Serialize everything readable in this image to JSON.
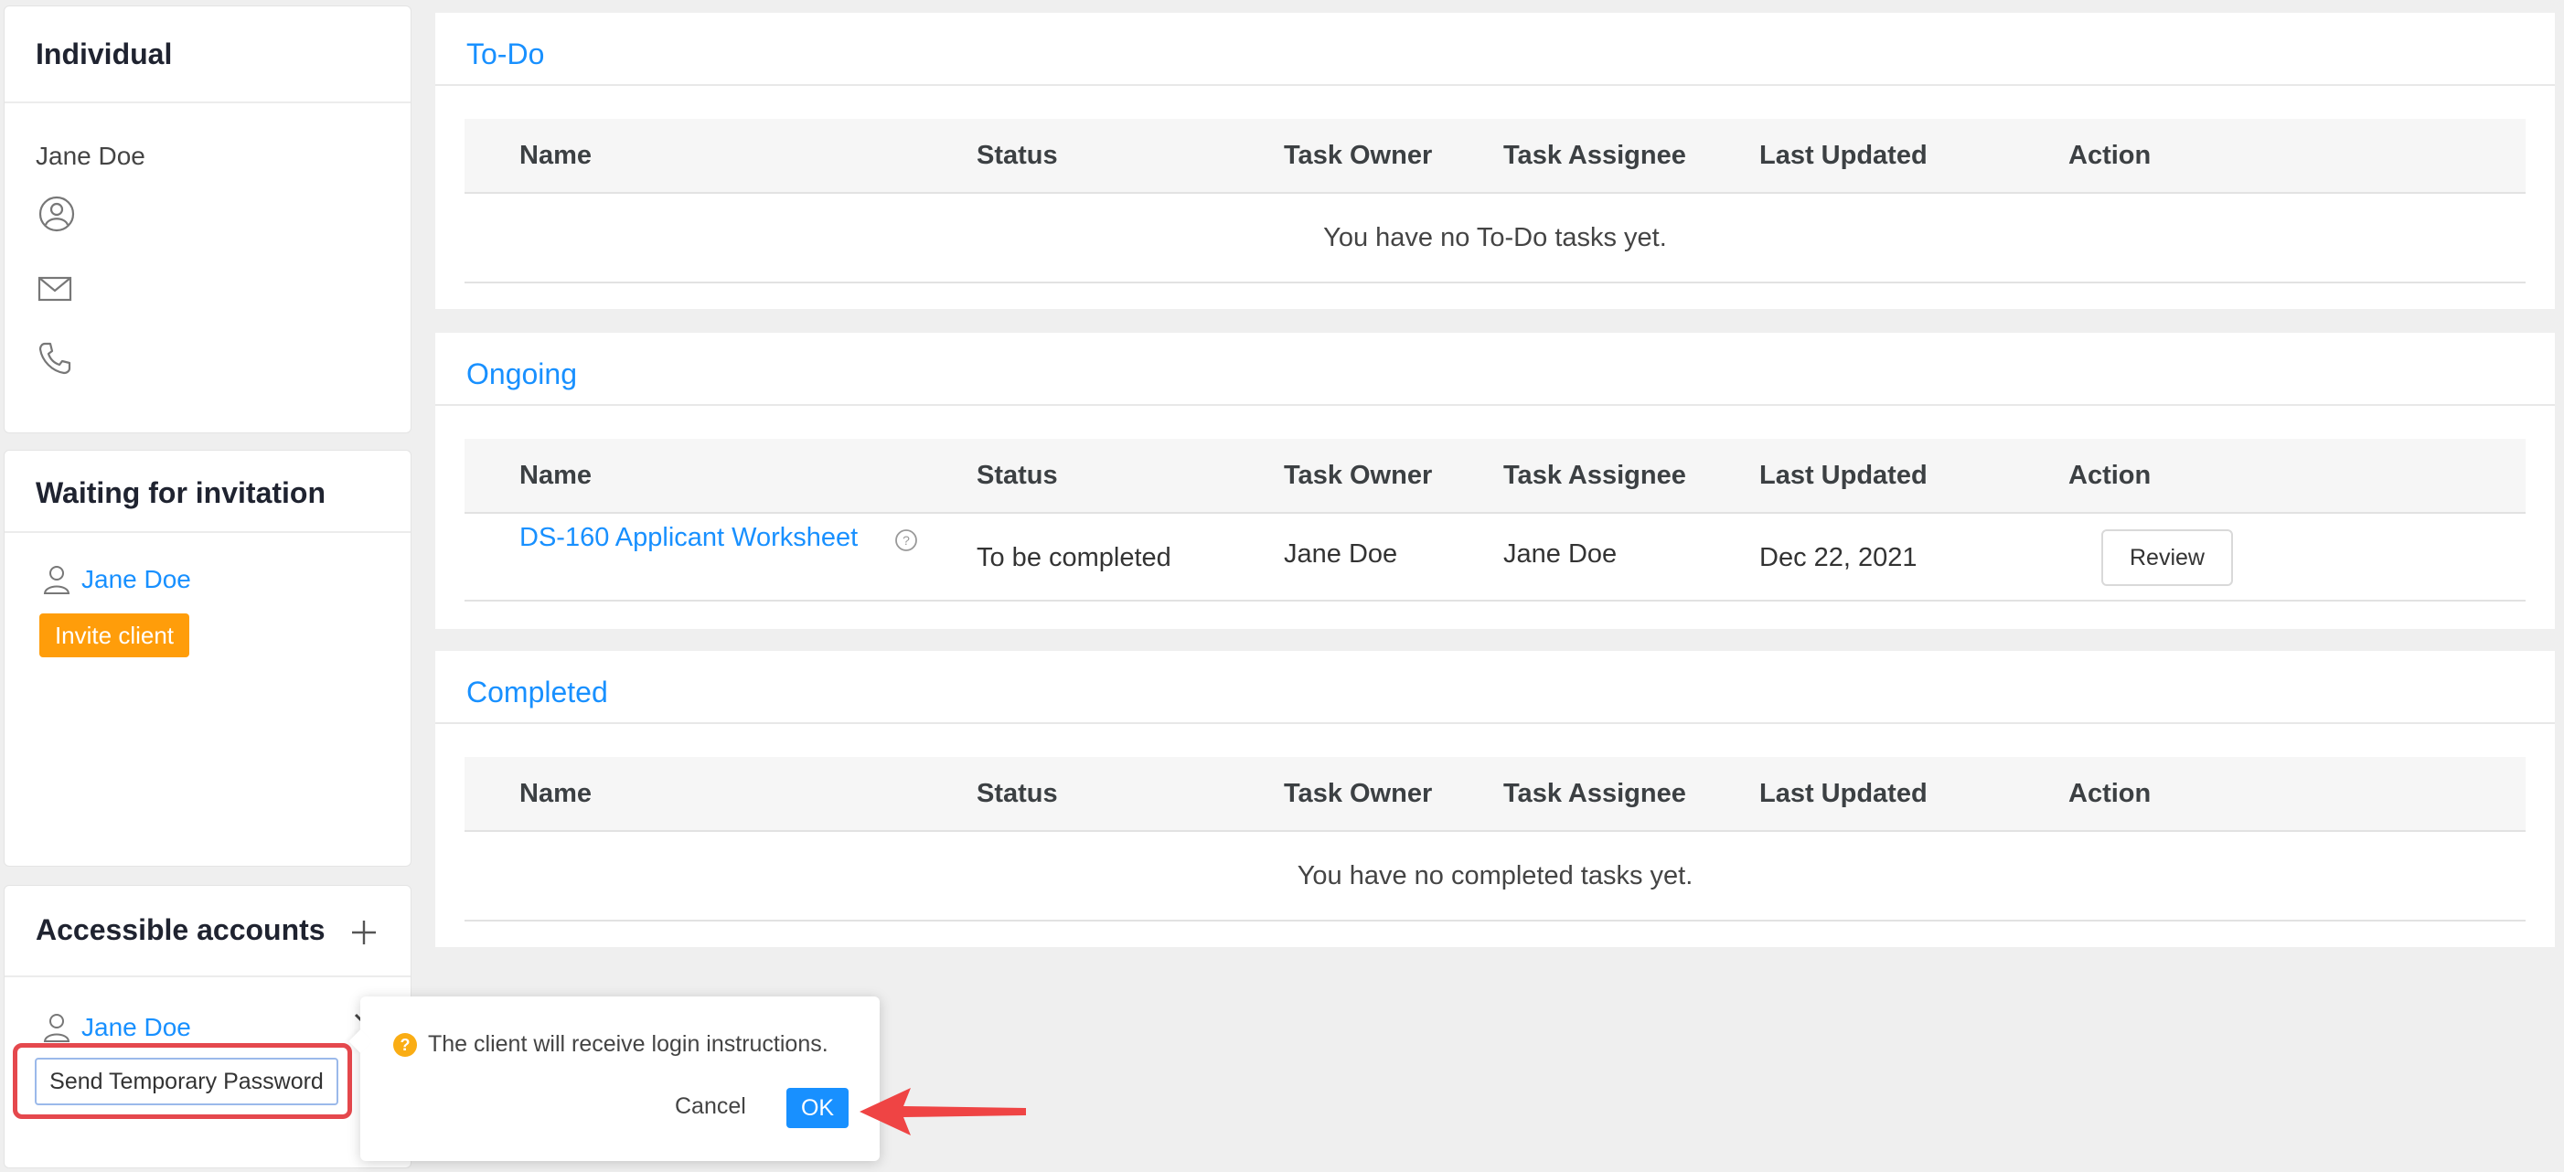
{
  "individual": {
    "title": "Individual",
    "name": "Jane Doe",
    "icons": [
      "user-circle-icon",
      "mail-icon",
      "phone-icon"
    ]
  },
  "waiting": {
    "title": "Waiting for invitation",
    "client_name": "Jane Doe",
    "invite_label": "Invite client"
  },
  "accounts": {
    "title": "Accessible accounts",
    "account_name": "Jane Doe",
    "send_password_label": "Send Temporary Password"
  },
  "columns": [
    "Name",
    "Status",
    "Task Owner",
    "Task Assignee",
    "Last Updated",
    "Action"
  ],
  "todo": {
    "title": "To-Do",
    "empty_message": "You have no To-Do tasks yet."
  },
  "ongoing": {
    "title": "Ongoing",
    "rows": [
      {
        "name": "DS-160 Applicant Worksheet",
        "status": "To be completed",
        "owner": "Jane Doe",
        "assignee": "Jane Doe",
        "updated": "Dec 22, 2021",
        "action": "Review"
      }
    ]
  },
  "completed": {
    "title": "Completed",
    "empty_message": "You have no completed tasks yet."
  },
  "popconfirm": {
    "message": "The client will receive login instructions.",
    "cancel_label": "Cancel",
    "ok_label": "OK"
  },
  "colors": {
    "accent": "#1890ff",
    "warning": "#ff9d0a",
    "annotation": "#e5484d"
  }
}
